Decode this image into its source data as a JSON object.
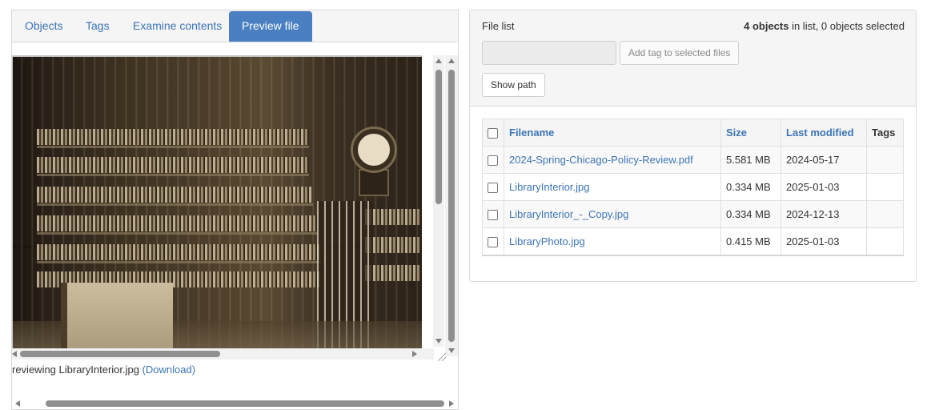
{
  "left_panel": {
    "tabs": [
      "Objects",
      "Tags",
      "Examine contents",
      "Preview file"
    ],
    "active_tab": "Preview file",
    "preview": {
      "caption_prefix": "reviewing LibraryInterior.jpg",
      "download_link": "(Download)"
    }
  },
  "right_panel": {
    "title": "File list",
    "count_bold": "4 objects",
    "count_rest": " in list, 0 objects selected",
    "tag_input_placeholder": "",
    "add_tag_button": "Add tag to selected files",
    "show_path_button": "Show path",
    "table": {
      "headers": {
        "filename": "Filename",
        "size": "Size",
        "last_modified": "Last modified",
        "tags": "Tags"
      },
      "rows": [
        {
          "filename": "2024-Spring-Chicago-Policy-Review.pdf",
          "size": "5.581 MB",
          "last_modified": "2024-05-17",
          "tags": ""
        },
        {
          "filename": "LibraryInterior.jpg",
          "size": "0.334 MB",
          "last_modified": "2025-01-03",
          "tags": ""
        },
        {
          "filename": "LibraryInterior_-_Copy.jpg",
          "size": "0.334 MB",
          "last_modified": "2024-12-13",
          "tags": ""
        },
        {
          "filename": "LibraryPhoto.jpg",
          "size": "0.415 MB",
          "last_modified": "2025-01-03",
          "tags": ""
        }
      ]
    }
  },
  "colors": {
    "accent": "#4a7fc1",
    "link": "#3c74b4"
  },
  "icons": [
    "scroll-up-icon",
    "scroll-down-icon",
    "scroll-left-icon",
    "scroll-right-icon",
    "resize-grip-icon"
  ]
}
